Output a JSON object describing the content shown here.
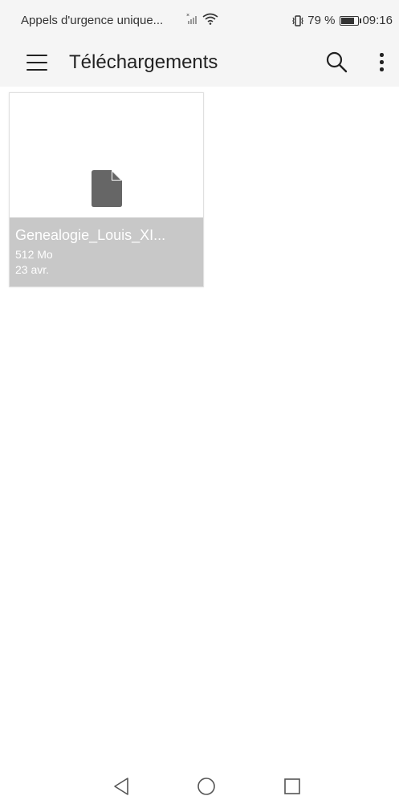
{
  "status_bar": {
    "carrier": "Appels d'urgence unique...",
    "signal_icon": "signal-x-icon",
    "wifi_icon": "wifi-icon",
    "vibrate_icon": "vibrate-icon",
    "battery_text": "79 %",
    "battery_level": 0.79,
    "time": "09:16"
  },
  "appbar": {
    "menu_icon": "hamburger-menu-icon",
    "title": "Téléchargements",
    "search_icon": "search-icon",
    "more_icon": "more-vert-icon"
  },
  "files": [
    {
      "icon": "file-icon",
      "name": "Genealogie_Louis_XI...",
      "size": "512 Mo",
      "date": "23 avr."
    }
  ],
  "nav": {
    "back_icon": "back-triangle-icon",
    "home_icon": "home-circle-icon",
    "recent_icon": "recent-square-icon"
  },
  "colors": {
    "bar_bg": "#f5f5f5",
    "card_info_bg": "#c8c8c8",
    "file_icon": "#666666"
  }
}
